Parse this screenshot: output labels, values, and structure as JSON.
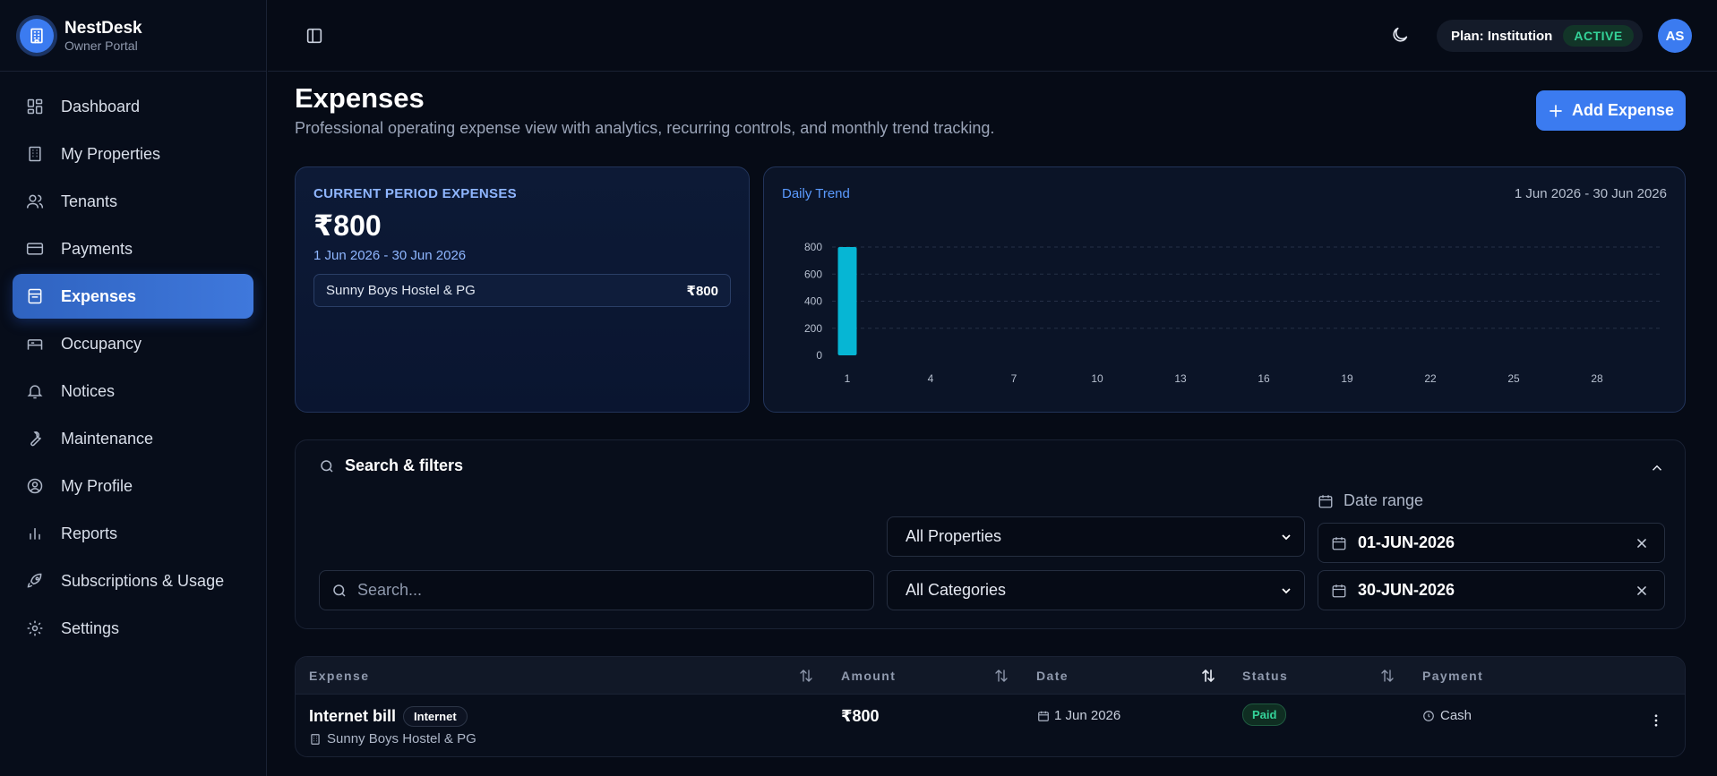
{
  "brand": {
    "name": "NestDesk",
    "subtitle": "Owner Portal"
  },
  "sidebar": {
    "items": [
      {
        "label": "Dashboard",
        "icon": "dashboard-icon"
      },
      {
        "label": "My Properties",
        "icon": "building-icon"
      },
      {
        "label": "Tenants",
        "icon": "users-icon"
      },
      {
        "label": "Payments",
        "icon": "credit-card-icon"
      },
      {
        "label": "Expenses",
        "icon": "receipt-icon",
        "active": true
      },
      {
        "label": "Occupancy",
        "icon": "bed-icon"
      },
      {
        "label": "Notices",
        "icon": "bell-icon"
      },
      {
        "label": "Maintenance",
        "icon": "wrench-icon"
      },
      {
        "label": "My Profile",
        "icon": "user-circle-icon"
      },
      {
        "label": "Reports",
        "icon": "bar-chart-icon"
      },
      {
        "label": "Subscriptions & Usage",
        "icon": "rocket-icon"
      },
      {
        "label": "Settings",
        "icon": "gear-icon"
      }
    ]
  },
  "topbar": {
    "plan_label": "Plan: Institution",
    "plan_status": "ACTIVE",
    "avatar_initials": "AS"
  },
  "page": {
    "title": "Expenses",
    "subtitle": "Professional operating expense view with analytics, recurring controls, and monthly trend tracking.",
    "add_button": "Add Expense"
  },
  "period_card": {
    "label": "CURRENT PERIOD EXPENSES",
    "amount": "₹800",
    "range": "1 Jun 2026 - 30 Jun 2026",
    "breakdown": [
      {
        "name": "Sunny Boys Hostel & PG",
        "amount": "₹800"
      }
    ]
  },
  "trend_card": {
    "title": "Daily Trend",
    "range": "1 Jun 2026 - 30 Jun 2026"
  },
  "chart_data": {
    "type": "bar",
    "title": "",
    "xlabel": "",
    "ylabel": "",
    "x": [
      1,
      2,
      3,
      4,
      5,
      6,
      7,
      8,
      9,
      10,
      11,
      12,
      13,
      14,
      15,
      16,
      17,
      18,
      19,
      20,
      21,
      22,
      23,
      24,
      25,
      26,
      27,
      28,
      29,
      30
    ],
    "values": [
      800,
      0,
      0,
      0,
      0,
      0,
      0,
      0,
      0,
      0,
      0,
      0,
      0,
      0,
      0,
      0,
      0,
      0,
      0,
      0,
      0,
      0,
      0,
      0,
      0,
      0,
      0,
      0,
      0,
      0
    ],
    "x_ticks": [
      1,
      4,
      7,
      10,
      13,
      16,
      19,
      22,
      25,
      28
    ],
    "y_ticks": [
      0,
      200,
      400,
      600,
      800
    ],
    "ylim": [
      0,
      800
    ],
    "xlim": [
      1,
      30
    ],
    "grid": true,
    "bar_color": "#06b6d4"
  },
  "filters": {
    "title": "Search & filters",
    "search_placeholder": "Search...",
    "property_select": "All Properties",
    "category_select": "All Categories",
    "date_range_label": "Date range",
    "date_from": "01-JUN-2026",
    "date_to": "30-JUN-2026"
  },
  "table": {
    "columns": [
      "Expense",
      "Amount",
      "Date",
      "Status",
      "Payment"
    ],
    "rows": [
      {
        "name": "Internet bill",
        "category": "Internet",
        "property": "Sunny Boys Hostel & PG",
        "amount": "₹800",
        "date": "1 Jun 2026",
        "status": "Paid",
        "payment": "Cash"
      }
    ]
  },
  "colors": {
    "accent": "#3b7bf0",
    "active_green": "#34d399",
    "chart_bar": "#06b6d4",
    "background": "#060b16"
  }
}
